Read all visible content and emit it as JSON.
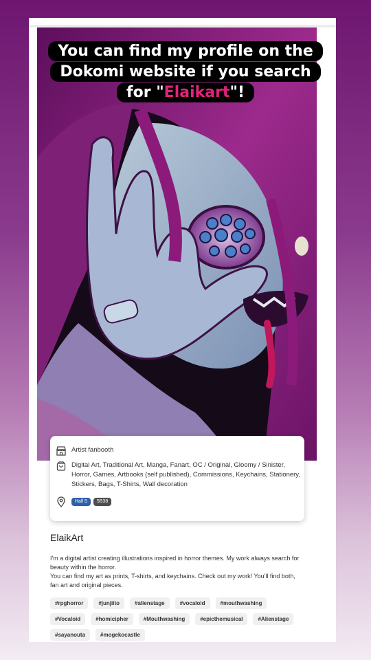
{
  "caption": {
    "line1": "You can find my profile on the",
    "line2": "Dokomi website if you search",
    "line3_pre": "for \"",
    "line3_highlight": "Elaikart",
    "line3_post": "\"!"
  },
  "artwork": {
    "description_icon": "artwork-image",
    "colors": {
      "hair": "#8c1a7a",
      "skin": "#9ab7c9",
      "background": "#140a18",
      "accent": "#e0247a"
    }
  },
  "info_card": {
    "type_label": "Artist fanbooth",
    "categories": "Digital Art, Traditional Art, Manga, Fanart, OC / Original, Gloomy / Sinister, Horror, Games, Artbooks (self published), Commissions, Keychains, Stationery, Stickers, Bags, T-Shirts, Wall decoration",
    "hall": "Hall 5",
    "booth": "5B38",
    "icons": {
      "type": "storefront-icon",
      "categories": "shopping-bag-icon",
      "location": "location-pin-icon"
    }
  },
  "profile": {
    "name": "ElaikArt",
    "description_1": "I'm a digital artist creating illustrations inspired in horror themes. My work always search for beauty within the horror.",
    "description_2": "You can find my art as prints, T-shirts, and keychains. Check out my work! You'll find both, fan art and original pieces."
  },
  "tags": [
    "#rpghorror",
    "#junjiito",
    "#alienstage",
    "#vocaloid",
    "#mouthwashing",
    "#Vocaloid",
    "#homicipher",
    "#Mouthwashing",
    "#epicthemusical",
    "#Alienstage",
    "#sayanouta",
    "#mogekocastle"
  ]
}
